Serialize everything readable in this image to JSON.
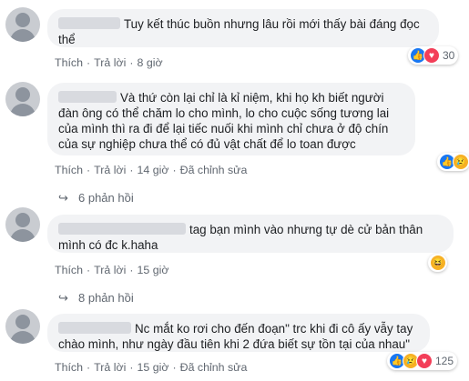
{
  "comments": [
    {
      "text": "Tuy kết thúc buồn nhưng lâu rồi mới thấy bài đáng đọc thể",
      "actions": {
        "like": "Thích",
        "reply": "Trả lời",
        "time": "8 giờ",
        "edited": ""
      },
      "reactions": {
        "icons": [
          "like-icon",
          "heart-icon"
        ],
        "count": "30"
      }
    },
    {
      "text": "Và thứ còn lại chỉ là kỉ niệm, khi họ kh biết người đàn ông có thể chăm lo cho mình, lo cho cuộc sống tương lai của mình thì ra đi để lại tiếc nuối khi mình chỉ chưa ở độ chín của sự nghiệp chưa thể có đủ vật chất để lo toan được",
      "actions": {
        "like": "Thích",
        "reply": "Trả lời",
        "time": "14 giờ",
        "edited": "Đã chỉnh sửa"
      },
      "reactions": {
        "icons": [
          "like-icon",
          "sad-icon"
        ],
        "count": ""
      },
      "replies": "6 phản hồi"
    },
    {
      "text": "tag bạn mình vào nhưng tự dè cử bản thân mình có đc k.haha",
      "actions": {
        "like": "Thích",
        "reply": "Trả lời",
        "time": "15 giờ",
        "edited": ""
      },
      "reactions": {
        "icons": [
          "haha-icon"
        ],
        "count": ""
      },
      "replies": "8 phản hồi"
    },
    {
      "text": "Nc mắt ko rơi cho đến đoạn\" trc khi đi cô ấy vẫy tay chào mình, như ngày đầu tiên khi 2 đứa biết sự tồn tại của nhau\"",
      "actions": {
        "like": "Thích",
        "reply": "Trả lời",
        "time": "15 giờ",
        "edited": "Đã chỉnh sửa"
      },
      "reactions": {
        "icons": [
          "like-icon",
          "sad-icon",
          "heart-icon"
        ],
        "count": "125"
      }
    }
  ]
}
